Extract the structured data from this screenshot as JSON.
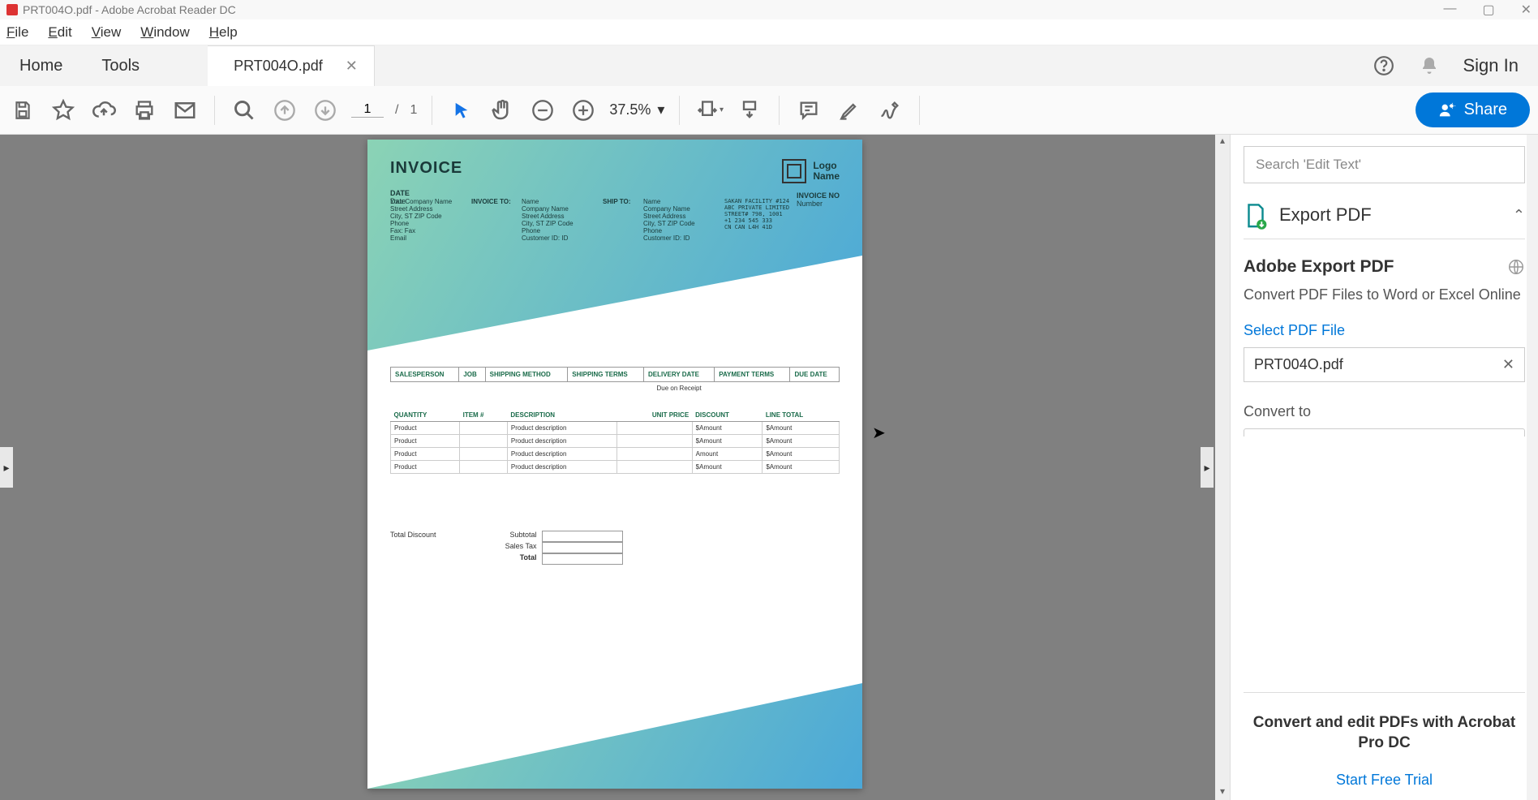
{
  "window": {
    "title": "PRT004O.pdf - Adobe Acrobat Reader DC"
  },
  "menu": {
    "file": "File",
    "edit": "Edit",
    "view": "View",
    "window": "Window",
    "help": "Help"
  },
  "tabs": {
    "home": "Home",
    "tools": "Tools",
    "file_tab": "PRT004O.pdf",
    "signin": "Sign In"
  },
  "toolbar": {
    "page_current": "1",
    "page_sep": "/",
    "page_total": "1",
    "zoom": "37.5%",
    "share": "Share"
  },
  "sidepanel": {
    "search_placeholder": "Search 'Edit Text'",
    "export_title": "Export PDF",
    "section_title": "Adobe Export PDF",
    "description": "Convert PDF Files to Word or Excel Online",
    "select_label": "Select PDF File",
    "selected_file": "PRT004O.pdf",
    "convert_to": "Convert to",
    "promo_text": "Convert and edit PDFs with Acrobat Pro DC",
    "start_trial": "Start Free Trial"
  },
  "document": {
    "title": "INVOICE",
    "date_label": "DATE",
    "date_value": "Date",
    "from_block": [
      "Your Company Name",
      "Street Address",
      "City, ST ZIP Code",
      "Phone",
      "Fax: Fax",
      "Email"
    ],
    "invoice_to_label": "INVOICE TO:",
    "invoice_to_block": [
      "Name",
      "Company Name",
      "Street Address",
      "City, ST ZIP Code",
      "Phone",
      "Customer ID: ID"
    ],
    "ship_to_label": "SHIP TO:",
    "ship_to_block": [
      "Name",
      "Company Name",
      "Street Address",
      "City, ST ZIP Code",
      "Phone",
      "Customer ID: ID"
    ],
    "side_block": [
      "SAKAN FACILITY #124",
      "ABC PRIVATE LIMITED",
      "STREET# 798, 1001",
      "+1 234 545 333",
      "CN  CAN  L4H 41D"
    ],
    "logo_name": "Logo Name",
    "invoice_no_label": "INVOICE NO",
    "invoice_no_value": "Number",
    "order_headers": [
      "SALESPERSON",
      "JOB",
      "SHIPPING METHOD",
      "SHIPPING TERMS",
      "DELIVERY DATE",
      "PAYMENT TERMS",
      "DUE DATE"
    ],
    "due_text": "Due on Receipt",
    "item_headers": [
      "QUANTITY",
      "ITEM #",
      "DESCRIPTION",
      "UNIT PRICE",
      "DISCOUNT",
      "LINE TOTAL"
    ],
    "items": [
      {
        "qty": "Product",
        "item": "",
        "desc": "Product description",
        "unit": "",
        "disc": "$Amount",
        "total": "$Amount"
      },
      {
        "qty": "Product",
        "item": "",
        "desc": "Product description",
        "unit": "",
        "disc": "$Amount",
        "total": "$Amount"
      },
      {
        "qty": "Product",
        "item": "",
        "desc": "Product description",
        "unit": "",
        "disc": "Amount",
        "total": "$Amount"
      },
      {
        "qty": "Product",
        "item": "",
        "desc": "Product description",
        "unit": "",
        "disc": "$Amount",
        "total": "$Amount"
      }
    ],
    "total_discount_label": "Total Discount",
    "subtotal_label": "Subtotal",
    "salestax_label": "Sales Tax",
    "total_label": "Total"
  },
  "colors": {
    "accent": "#0077d9",
    "teal": "#1a6b4a"
  }
}
